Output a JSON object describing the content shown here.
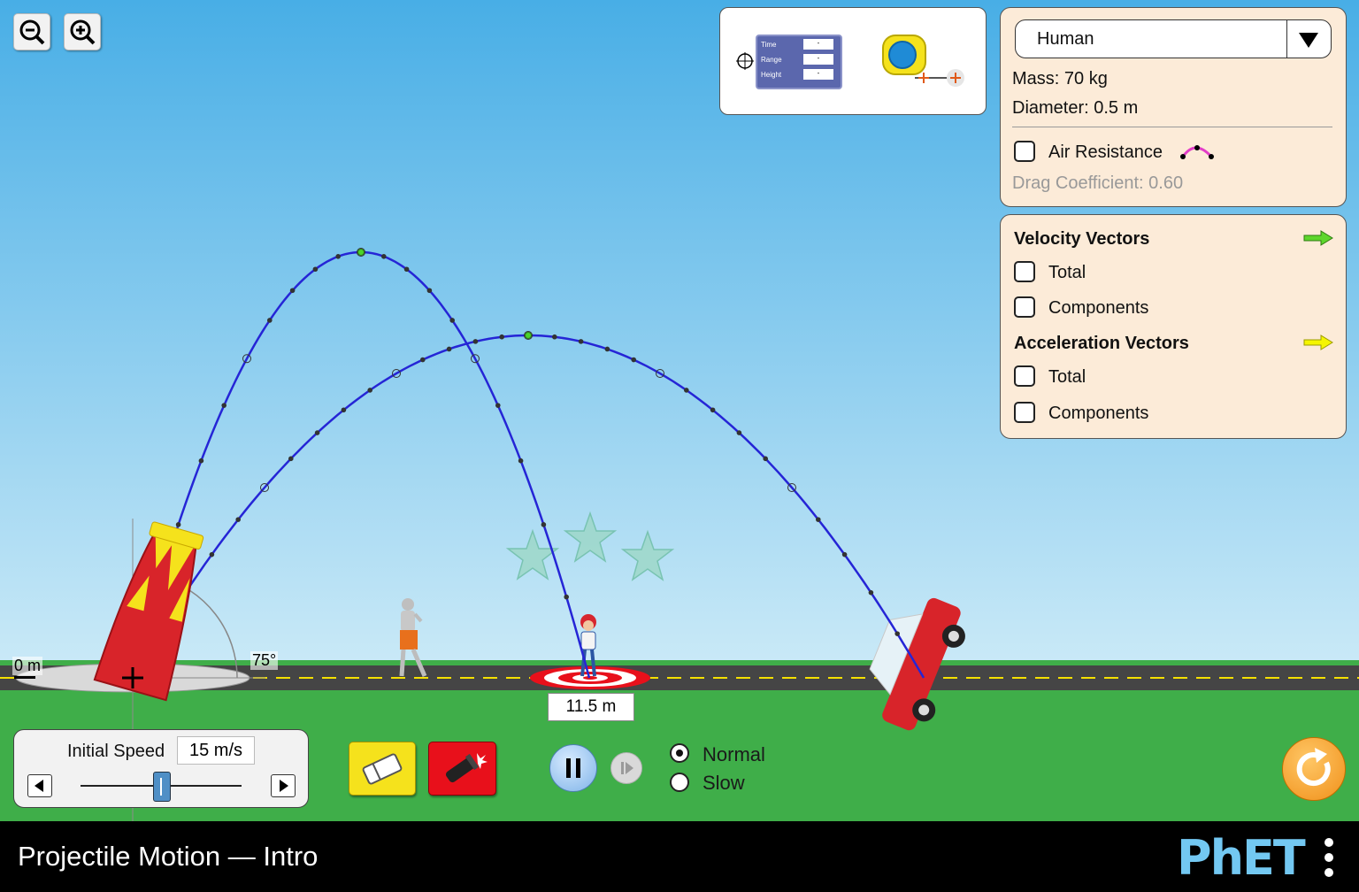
{
  "app_title": "Projectile Motion — Intro",
  "brand": "PhET",
  "zoom": {
    "out_icon": "zoom-out-icon",
    "in_icon": "zoom-in-icon"
  },
  "tools": {
    "time_label": "Time",
    "range_label": "Range",
    "height_label": "Height",
    "time_value": "-",
    "range_value": "-",
    "height_value": "-"
  },
  "projectile": {
    "selected": "Human",
    "mass": "Mass: 70 kg",
    "diameter": "Diameter: 0.5 m",
    "air_resistance": "Air Resistance",
    "air_resistance_checked": false,
    "drag": "Drag Coefficient: 0.60"
  },
  "vectors": {
    "velocity_title": "Velocity Vectors",
    "velocity_total": "Total",
    "velocity_components": "Components",
    "acceleration_title": "Acceleration Vectors",
    "acceleration_total": "Total",
    "acceleration_components": "Components",
    "velocity_color": "#5dd62c",
    "acceleration_color": "#f5f500"
  },
  "scene": {
    "height_label": "0 m",
    "angle_label": "75°",
    "target_label": "11.5 m",
    "sky_top": "#48aee6",
    "grass": "#3fae49"
  },
  "speed": {
    "label": "Initial Speed",
    "value": "15 m/s",
    "fraction": 0.5
  },
  "controls": {
    "erase_icon": "eraser-icon",
    "fire_icon": "cannon-fire-icon",
    "pause_icon": "pause-icon",
    "step_icon": "step-forward-icon",
    "normal": "Normal",
    "slow": "Slow",
    "selected_speed": "Normal",
    "reset_icon": "reset-icon"
  }
}
